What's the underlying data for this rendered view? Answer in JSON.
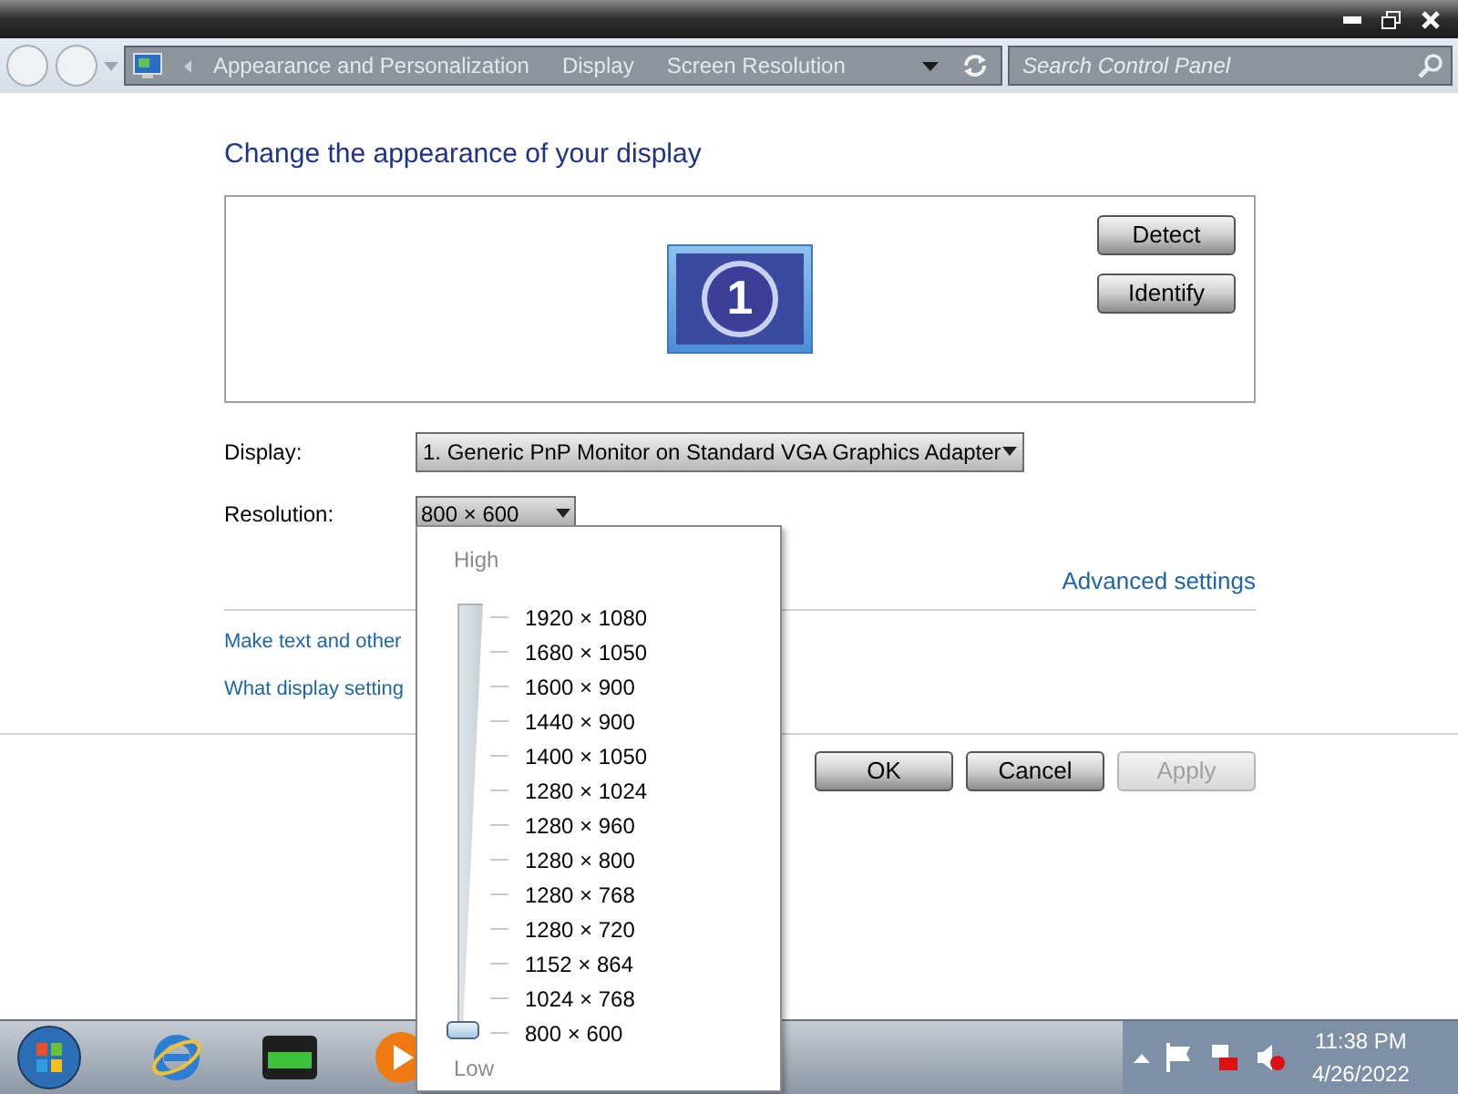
{
  "address_bar": {
    "breadcrumbs": [
      "Appearance and Personalization",
      "Display",
      "Screen Resolution"
    ],
    "search": {
      "placeholder": "Search Control Panel"
    }
  },
  "heading": "Change the appearance of your display",
  "monitor": {
    "number": "1"
  },
  "side_buttons": [
    "Detect",
    "Identify"
  ],
  "display": {
    "label": "Display:",
    "value": "1. Generic PnP Monitor on Standard VGA Graphics Adapter"
  },
  "resolution": {
    "label": "Resolution:",
    "value": "800 × 600",
    "expanded": true
  },
  "advanced_link": "Advanced settings",
  "links": [
    "Make text and other",
    "What display setting"
  ],
  "buttons": [
    {
      "label": "OK",
      "disabled": false
    },
    {
      "label": "Cancel",
      "disabled": false
    },
    {
      "label": "Apply",
      "disabled": true
    }
  ],
  "resolution_popup": {
    "high_label": "High",
    "low_label": "Low",
    "level": 0,
    "options": [
      "1920 × 1080",
      "1680 × 1050",
      "1600 × 900",
      "1440 × 900",
      "1400 × 1050",
      "1280 × 1024",
      "1280 × 960",
      "1280 × 800",
      "1280 × 768",
      "1280 × 720",
      "1152 × 864",
      "1024 × 768",
      "800 × 600"
    ]
  },
  "tray": {
    "time": "11:38 PM",
    "date": "4/26/2022"
  }
}
